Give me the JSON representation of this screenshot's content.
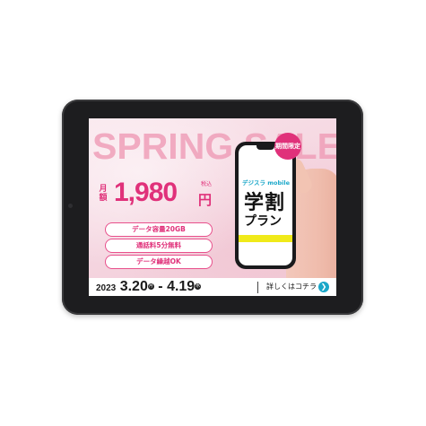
{
  "banner": {
    "headline": "SPRING SALE",
    "price": {
      "prefix": "月\n額",
      "value": "1,980",
      "currency": "円",
      "tax_note": "税込"
    },
    "features": [
      "データ容量20GB",
      "通話料5分無料",
      "データ繰越OK"
    ],
    "phone": {
      "brand": "デジスラ mobile",
      "plan_title": "学割",
      "plan_subtitle": "プラン"
    },
    "badge": "期間限定",
    "period": {
      "year": "2023",
      "start": "3.20",
      "start_day": "月",
      "separator": " - ",
      "end": "4.19",
      "end_day": "水"
    },
    "details_link": {
      "label": "詳しくはコチラ",
      "icon": "arrow-right-icon"
    }
  },
  "colors": {
    "accent": "#e0317a",
    "headline": "#ef9bb6",
    "link_icon": "#1aa7c9",
    "highlight": "#f0ea1a",
    "bezel": "#1d1d1f"
  }
}
